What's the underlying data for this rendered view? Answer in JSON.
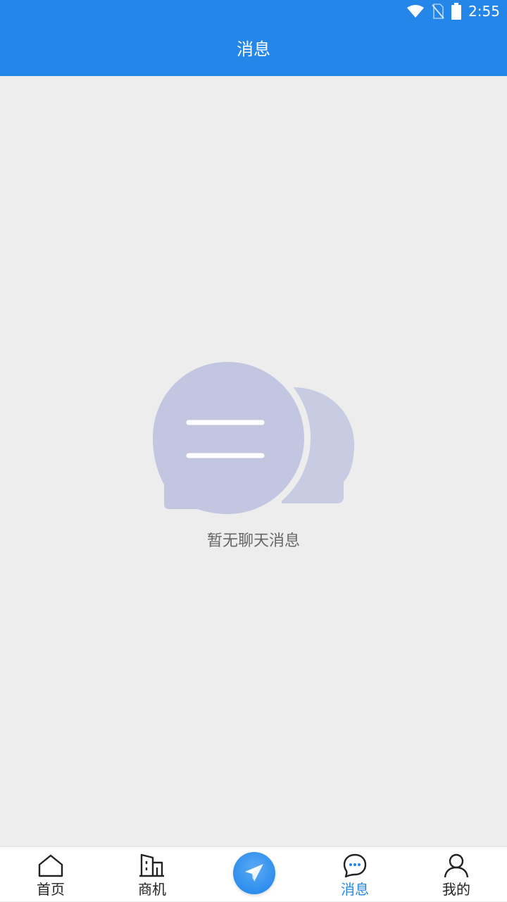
{
  "status_bar": {
    "time": "2:55",
    "icons": [
      "wifi-icon",
      "no-sim-icon",
      "battery-icon"
    ]
  },
  "header": {
    "title": "消息"
  },
  "empty_state": {
    "icon": "chat-bubbles-icon",
    "message": "暂无聊天消息"
  },
  "tab_bar": {
    "tabs": [
      {
        "label": "首页",
        "icon": "home-icon",
        "active": false
      },
      {
        "label": "商机",
        "icon": "building-icon",
        "active": false
      },
      {
        "label": "",
        "icon": "paper-plane-icon",
        "active": false
      },
      {
        "label": "消息",
        "icon": "chat-icon",
        "active": true
      },
      {
        "label": "我的",
        "icon": "user-icon",
        "active": false
      }
    ]
  },
  "colors": {
    "primary": "#2486e8",
    "background": "#ededed",
    "illustration": "#c2c6e0",
    "text_muted": "#666666"
  }
}
